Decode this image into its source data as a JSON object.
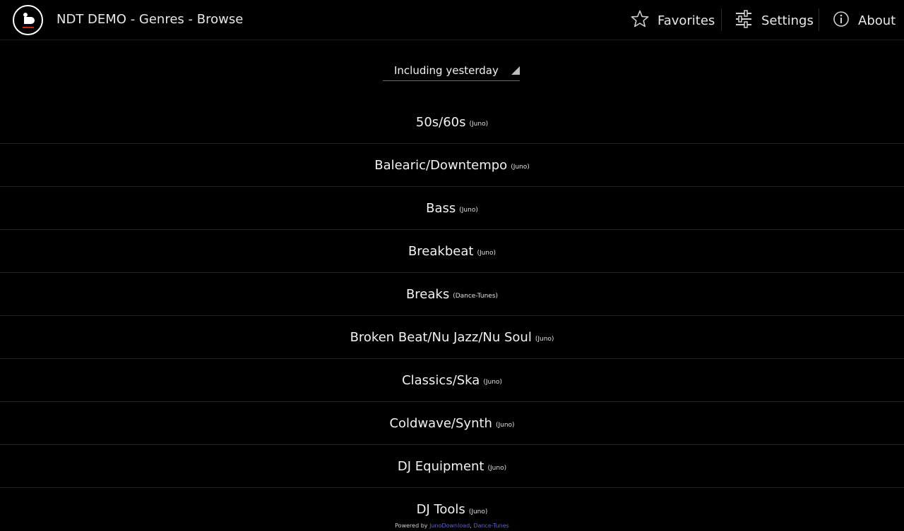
{
  "app": {
    "title": "NDT DEMO - Genres - Browse"
  },
  "actions": {
    "favorites": "Favorites",
    "settings": "Settings",
    "about": "About"
  },
  "filter": {
    "selected": "Including yesterday"
  },
  "genres": [
    {
      "name": "50s/60s",
      "source": "(Juno)"
    },
    {
      "name": "Balearic/Downtempo",
      "source": "(Juno)"
    },
    {
      "name": "Bass",
      "source": "(Juno)"
    },
    {
      "name": "Breakbeat",
      "source": "(Juno)"
    },
    {
      "name": "Breaks",
      "source": "(Dance-Tunes)"
    },
    {
      "name": "Broken Beat/Nu Jazz/Nu Soul",
      "source": "(Juno)"
    },
    {
      "name": "Classics/Ska",
      "source": "(Juno)"
    },
    {
      "name": "Coldwave/Synth",
      "source": "(Juno)"
    },
    {
      "name": "DJ Equipment",
      "source": "(Juno)"
    },
    {
      "name": "DJ Tools",
      "source": "(Juno)"
    }
  ],
  "footer": {
    "prefix": "Powered by",
    "link1": "JunoDownload",
    "sep": ",",
    "link2": "Dance-Tunes"
  },
  "colors": {
    "background": "#000000",
    "link": "#5a63d6"
  }
}
